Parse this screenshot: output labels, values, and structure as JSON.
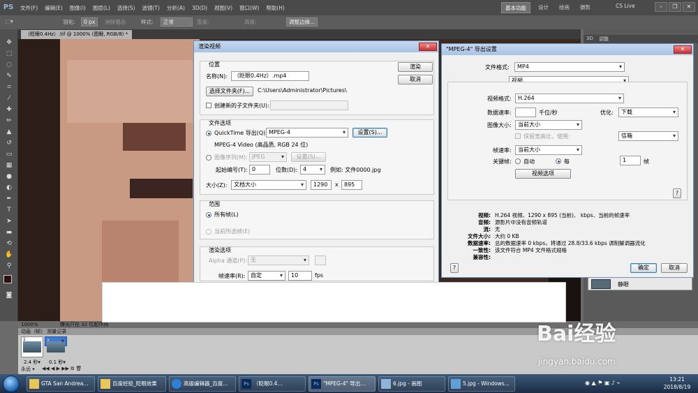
{
  "menubar": {
    "logo": "PS",
    "items": [
      "文件(F)",
      "编辑(E)",
      "图像(I)",
      "图层(L)",
      "选择(S)",
      "滤镜(T)",
      "分析(A)",
      "3D(D)",
      "视图(V)",
      "窗口(W)",
      "帮助(H)"
    ],
    "workspaces": [
      "基本功能",
      "设计",
      "绘画",
      "摄影"
    ],
    "cslive": "CS Live"
  },
  "options": {
    "feather_label": "羽化:",
    "feather_value": "0 px",
    "antialias": "消除锯齿",
    "style_label": "样式:",
    "style_value": "正常",
    "width_label": "宽度:",
    "height_label": "高度:",
    "refine": "调整边缘..."
  },
  "document_tab": "（眨眼0.4Hz）.tif @ 1000% (图眼, RGB/8) *",
  "right_panel": {
    "tab_3d": "3D",
    "tab_adjust": "调整",
    "layer_name": "静眼"
  },
  "status": {
    "zoom": "1000%",
    "message": "曝光只在 32 位起作用"
  },
  "animation": {
    "header": "动画（帧）  测量记录",
    "frames": [
      {
        "n": "1",
        "delay": "2.4 秒▾"
      },
      {
        "n": "2",
        "delay": "0.1 秒▾"
      }
    ],
    "loop": "永远 ▾"
  },
  "render_dialog": {
    "title": "渲染视频",
    "location": {
      "legend": "位置",
      "name_label": "名称(N):",
      "name_value": "（眨眼0.4Hz）.mp4",
      "choose_folder": "选择文件夹(F)...",
      "path": "C:\\Users\\Administrator\\Pictures\\",
      "subfolder": "创建新的子文件夹(U):"
    },
    "file_options": {
      "legend": "文件选项",
      "quicktime_label": "QuickTime 导出(Q):",
      "quicktime_value": "MPEG-4",
      "settings": "设置(S)...",
      "desc": "MPEG-4 Video (高品质, RGB 24 位)",
      "image_seq_label": "图像序列(M):",
      "image_seq_value": "JPEG",
      "image_seq_settings": "设置(S)...",
      "start_label": "起始编号(T):",
      "start_value": "0",
      "digits_label": "位数(D):",
      "digits_value": "4",
      "example": "例如: 文件0000.jpg",
      "size_label": "大小(Z):",
      "size_value": "文档大小",
      "width": "1290",
      "x": "x",
      "height": "895"
    },
    "range": {
      "legend": "范围",
      "all_frames": "所有帧(L)",
      "selected_frames": "当前所选帧(E)"
    },
    "render_options": {
      "legend": "渲染选项",
      "alpha_label": "Alpha 通道(P):",
      "alpha_value": "无",
      "fps_label": "帧速率(R):",
      "fps_value": "自定",
      "fps_number": "10",
      "fps_unit": "fps"
    },
    "render_btn": "渲染",
    "cancel_btn": "取消"
  },
  "mpeg_dialog": {
    "title": "\"MPEG-4\" 导出设置",
    "format_label": "文件格式:",
    "format_value": "MP4",
    "tab_value": "视频",
    "video_format_label": "视频格式:",
    "video_format_value": "H.264",
    "data_rate_label": "数据速率:",
    "data_rate_unit": "千位/秒",
    "optimize_label": "优化:",
    "optimize_value": "下载",
    "image_size_label": "图像大小:",
    "image_size_value": "当前大小",
    "keep_ratio": "保留宽高比，使用:",
    "keep_ratio_value": "信箱",
    "frame_rate_label": "帧速率:",
    "frame_rate_value": "当前大小",
    "keyframe_label": "关键帧:",
    "keyframe_auto": "自动",
    "keyframe_every": "每",
    "keyframe_number": "1",
    "keyframe_unit": "帧",
    "video_options": "视频选项",
    "help": "?",
    "summary": [
      {
        "k": "视频:",
        "v": "H.264 视频、1290 x 895 (当前)、 kbps、当前的帧速率"
      },
      {
        "k": "音频:",
        "v": "源影片中没有音频轨道"
      },
      {
        "k": "流:",
        "v": "无"
      },
      {
        "k": "文件大小:",
        "v": "大约 0 KB"
      },
      {
        "k": "数据速率:",
        "v": "总的数据速率 0 kbps，将通过 28.8/33.6 kbps 调制解调器流化"
      },
      {
        "k": "一致性:",
        "v": "该文件符合 MP4 文件格式规格"
      },
      {
        "k": "兼容性:",
        "v": ""
      }
    ],
    "ok": "确定",
    "cancel": "取消"
  },
  "taskbar": {
    "items": [
      {
        "label": "GTA San Andrea...",
        "icon": "folder-icon"
      },
      {
        "label": "百度经验_眨眼效果",
        "icon": "folder-icon"
      },
      {
        "label": "高级编辑器_百度...",
        "icon": "ie-icon"
      },
      {
        "label": "（眨眼0.4...",
        "icon": "photoshop-icon"
      },
      {
        "label": "\"MPEG-4\" 导出...",
        "icon": "photoshop-icon"
      },
      {
        "label": "6.jpg - 画图",
        "icon": "paint-icon"
      },
      {
        "label": "5.jpg - Windows...",
        "icon": "photo-viewer-icon"
      }
    ],
    "time": "13:21",
    "date": "2018/8/19"
  },
  "watermark": {
    "logo": "Bai经验",
    "url": "jingyan.baidu.com"
  },
  "colors": {
    "ps_dark": "#4a4a4a",
    "dialog_bg": "#f0f0f0",
    "title_blue": "#a9c3e4",
    "taskbar": "#1c2c44"
  }
}
